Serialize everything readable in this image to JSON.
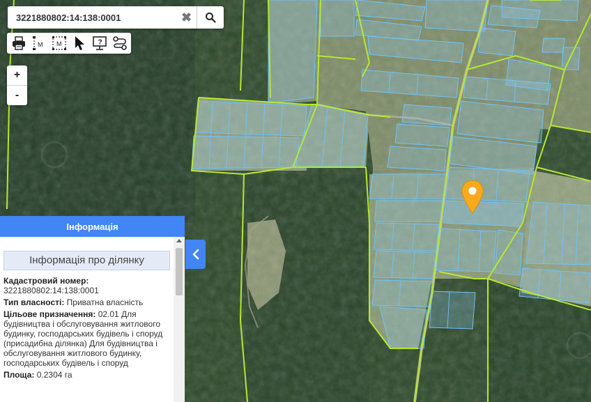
{
  "search": {
    "value": "3221880802:14:138:0001"
  },
  "icons": {
    "clear": "close-icon",
    "search": "search-icon",
    "print": "printer-icon",
    "measure_line": "measure-line-icon",
    "measure_area": "measure-area-icon",
    "select": "cursor-icon",
    "info": "info-screen-icon",
    "route": "route-icon",
    "marker": "location-pin-icon",
    "collapse": "chevron-left-icon"
  },
  "toolbar": {
    "measure_line_label": "M",
    "measure_area_label": "M"
  },
  "zoom": {
    "in_label": "+",
    "out_label": "-"
  },
  "panel": {
    "header": "Інформація",
    "section_title": "Інформація про ділянку",
    "fields": [
      {
        "label": "Кадастровий номер:",
        "value": "3221880802:14:138:0001"
      },
      {
        "label": "Тип власності:",
        "value": "Приватна власність"
      },
      {
        "label": "Цільове призначення:",
        "value": "02.01 Для будівництва і обслуговування житлового будинку, господарських будівель і споруд (присадибна ділянка) Для будівництва і обслуговування житлового будинку, господарських будівель і споруд"
      },
      {
        "label": "Площа:",
        "value": "0.2304 га"
      }
    ]
  },
  "colors": {
    "accent": "#4285f4",
    "parcel_fill": "#8ec8f0",
    "parcel_stroke": "#6ec3ff",
    "boundary": "#b6e831",
    "marker": "#f9a91c",
    "forest": "#2e4a2b",
    "field": "#8a9a72"
  }
}
